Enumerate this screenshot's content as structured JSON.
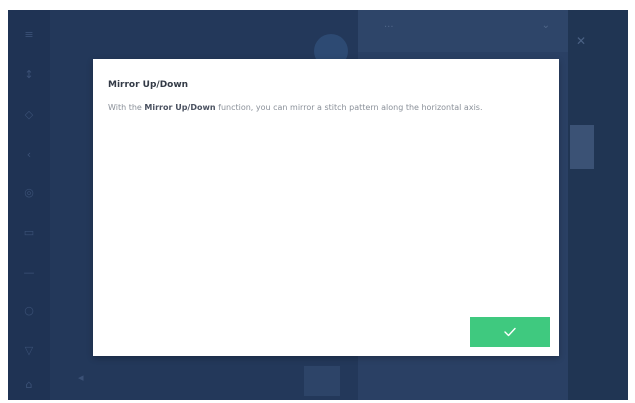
{
  "dialog": {
    "title": "Mirror Up/Down",
    "body_prefix": "With the ",
    "body_bold": "Mirror Up/Down",
    "body_suffix": " function, you can mirror a stitch pattern along the horizontal axis.",
    "confirm_icon": "checkmark-icon"
  },
  "colors": {
    "screen_background": "#23385a",
    "dialog_background": "#ffffff",
    "confirm_button": "#3fc97f"
  }
}
